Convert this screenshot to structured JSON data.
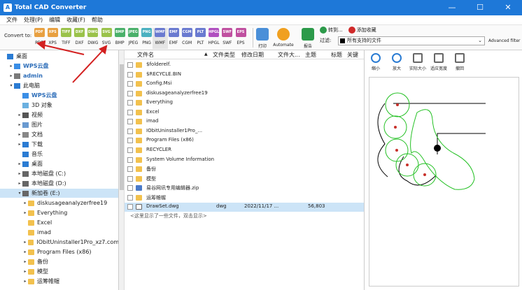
{
  "window": {
    "title": "Total CAD Converter",
    "app_icon": "A",
    "minimize": "—",
    "maximize": "☐",
    "close": "✕"
  },
  "menu": [
    "文件",
    "处理(P)",
    "编辑",
    "收藏(F)",
    "帮助"
  ],
  "toolbar": {
    "convert_to": "Convert to:",
    "formats": [
      {
        "label": "PDF",
        "color": "#e8a040"
      },
      {
        "label": "XPS",
        "color": "#e8a040"
      },
      {
        "label": "TIFF",
        "color": "#9ac24a"
      },
      {
        "label": "DXF",
        "color": "#9ac24a"
      },
      {
        "label": "DWG",
        "color": "#9ac24a"
      },
      {
        "label": "SVG",
        "color": "#9ac24a"
      },
      {
        "label": "BMP",
        "color": "#4ab06a"
      },
      {
        "label": "JPEG",
        "color": "#4ab06a"
      },
      {
        "label": "PNG",
        "color": "#4ab0c0"
      },
      {
        "label": "WMF",
        "color": "#6a7ad0"
      },
      {
        "label": "EMF",
        "color": "#6a7ad0"
      },
      {
        "label": "CGM",
        "color": "#6a7ad0"
      },
      {
        "label": "PLT",
        "color": "#6a7ad0"
      },
      {
        "label": "HPGL",
        "color": "#b050c0"
      },
      {
        "label": "SWF",
        "color": "#c050a0"
      },
      {
        "label": "EPS",
        "color": "#c050a0"
      }
    ],
    "print": "打印",
    "automate": "Automate",
    "report": "报告"
  },
  "topright": {
    "goto": "转到...",
    "add_fav": "添加收藏",
    "filter_label": "过滤:",
    "filter_value": "所有支持的文件",
    "advanced": "Advanced filter"
  },
  "tree": [
    {
      "label": "桌面",
      "level": 0,
      "arrow": "",
      "icon": "#2b7cd3"
    },
    {
      "label": "WPS云盘",
      "level": 1,
      "arrow": "▸",
      "icon": "#3a8ee6",
      "bold": true
    },
    {
      "label": "admin",
      "level": 1,
      "arrow": "▸",
      "icon": "#7a7a7a",
      "bold": true
    },
    {
      "label": "此电脑",
      "level": 1,
      "arrow": "▾",
      "icon": "#2b7cd3"
    },
    {
      "label": "WPS云盘",
      "level": 2,
      "arrow": "",
      "icon": "#3a8ee6",
      "bold": true
    },
    {
      "label": "3D 对象",
      "level": 2,
      "arrow": "",
      "icon": "#6ab0e0"
    },
    {
      "label": "视频",
      "level": 2,
      "arrow": "▸",
      "icon": "#555"
    },
    {
      "label": "图片",
      "level": 2,
      "arrow": "▸",
      "icon": "#6a9ad0"
    },
    {
      "label": "文档",
      "level": 2,
      "arrow": "▸",
      "icon": "#888"
    },
    {
      "label": "下载",
      "level": 2,
      "arrow": "▸",
      "icon": "#2b7cd3"
    },
    {
      "label": "音乐",
      "level": 2,
      "arrow": "",
      "icon": "#2b7cd3"
    },
    {
      "label": "桌面",
      "level": 2,
      "arrow": "▸",
      "icon": "#2b7cd3"
    },
    {
      "label": "本地磁盘 (C:)",
      "level": 2,
      "arrow": "▸",
      "icon": "#666"
    },
    {
      "label": "本地磁盘 (D:)",
      "level": 2,
      "arrow": "▸",
      "icon": "#666"
    },
    {
      "label": "新加卷 (E:)",
      "level": 2,
      "arrow": "▾",
      "icon": "#666",
      "selected": true
    },
    {
      "label": "diskusageanalyzerfree19",
      "level": 3,
      "arrow": "▸",
      "icon": "folder"
    },
    {
      "label": "Everything",
      "level": 3,
      "arrow": "▸",
      "icon": "folder"
    },
    {
      "label": "Excel",
      "level": 3,
      "arrow": "",
      "icon": "folder"
    },
    {
      "label": "imad",
      "level": 3,
      "arrow": "",
      "icon": "folder"
    },
    {
      "label": "IObitUninstaller1Pro_xz7.com",
      "level": 3,
      "arrow": "▸",
      "icon": "folder"
    },
    {
      "label": "Program Files (x86)",
      "level": 3,
      "arrow": "▸",
      "icon": "folder"
    },
    {
      "label": "备份",
      "level": 3,
      "arrow": "▸",
      "icon": "folder"
    },
    {
      "label": "模型",
      "level": 3,
      "arrow": "▸",
      "icon": "folder"
    },
    {
      "label": "运筹帷幄",
      "level": 3,
      "arrow": "▸",
      "icon": "folder"
    }
  ],
  "files": {
    "headers": {
      "name": "文件名",
      "type": "文件类型",
      "date": "修改日期",
      "size": "文件大...",
      "subject": "主题",
      "title": "标题",
      "keywords": "关键"
    },
    "rows": [
      {
        "name": "$folderelf."
      },
      {
        "name": "$RECYCLE.BIN"
      },
      {
        "name": "Config.Msi"
      },
      {
        "name": "diskusageanalyzerfree19"
      },
      {
        "name": "Everything"
      },
      {
        "name": "Excel"
      },
      {
        "name": "imad"
      },
      {
        "name": "IObitUninstaller1Pro_..."
      },
      {
        "name": "Program Files (x86)"
      },
      {
        "name": "RECYCLER"
      },
      {
        "name": "System Volume Information"
      },
      {
        "name": "备份"
      },
      {
        "name": "模型"
      },
      {
        "name": "易谷网讯专用编辑器.zip"
      },
      {
        "name": "运筹帷幄"
      },
      {
        "name": "DrawSet.dwg",
        "type": "dwg",
        "date": "2022/11/17 ...",
        "size": "56,803",
        "selected": true
      }
    ],
    "hint": "<这里显示了一些文件，双击显示>"
  },
  "preview": {
    "buttons": [
      "缩小",
      "放大",
      "实际大小",
      "适应宽度",
      "撤回"
    ]
  }
}
